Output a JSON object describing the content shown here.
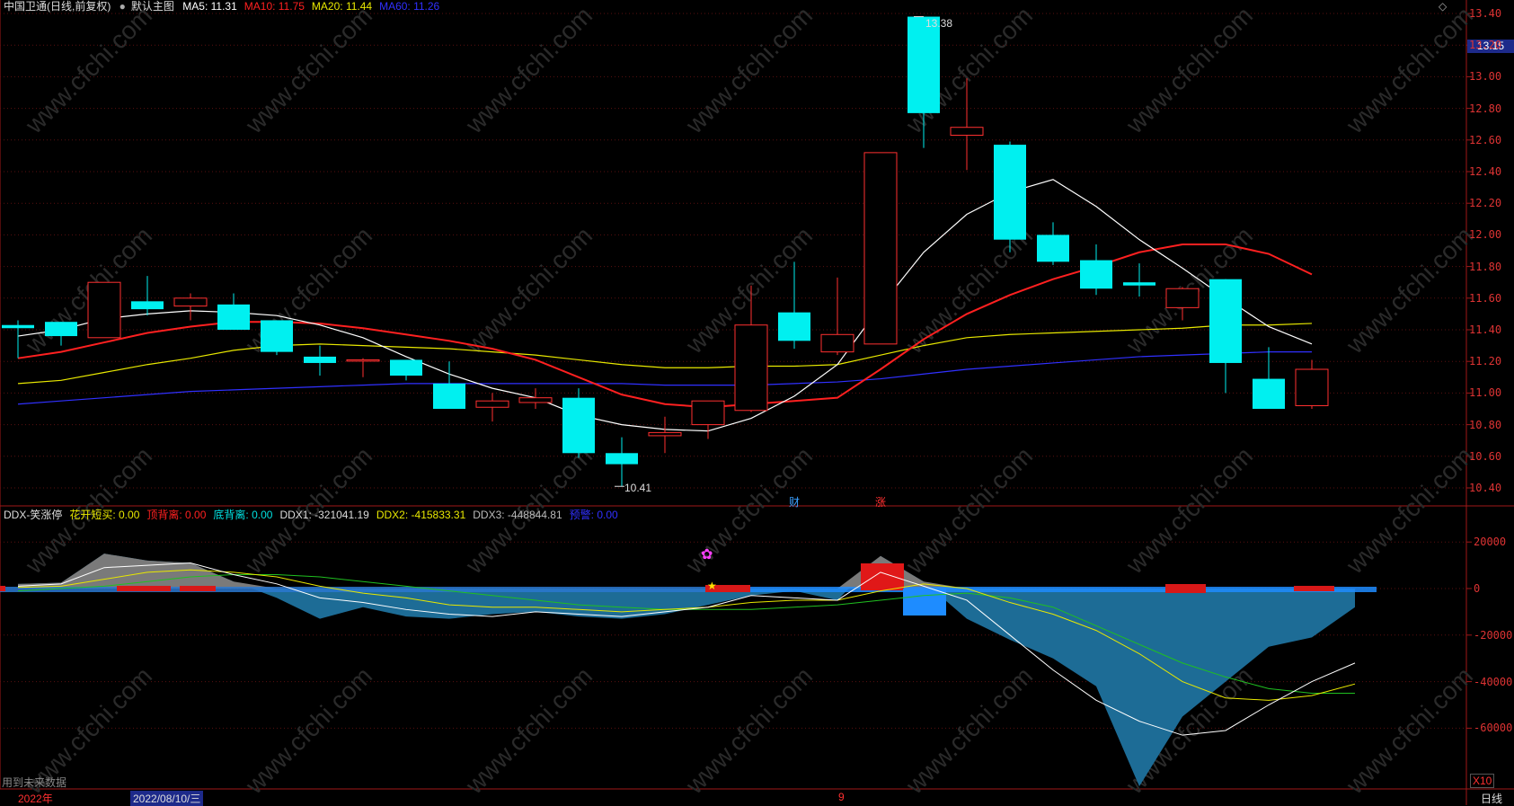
{
  "window": {
    "title": "中国卫通(日线,前复权)",
    "main_view": "默认主图",
    "top_right_icon": "diamond-icon"
  },
  "main_indicators": [
    {
      "label": "MA5: 11.31",
      "color": "#ffffff"
    },
    {
      "label": "MA10: 11.75",
      "color": "#ff2020"
    },
    {
      "label": "MA20: 11.44",
      "color": "#e8e800"
    },
    {
      "label": "MA60: 11.26",
      "color": "#3030ff"
    }
  ],
  "sub_indicators": [
    {
      "label": "DDX-笑涨停",
      "color": "#dddddd"
    },
    {
      "label": "花开短买: 0.00",
      "color": "#e8e800"
    },
    {
      "label": "顶背离: 0.00",
      "color": "#ff2020"
    },
    {
      "label": "底背离: 0.00",
      "color": "#00e0e0"
    },
    {
      "label": "DDX1: -321041.19",
      "color": "#dddddd"
    },
    {
      "label": "DDX2: -415833.31",
      "color": "#e8e800"
    },
    {
      "label": "DDX3: -448844.81",
      "color": "#bbbbbb"
    },
    {
      "label": "预警: 0.00",
      "color": "#3030ff"
    }
  ],
  "price_axis": [
    "13.40",
    "13.20",
    "13.00",
    "12.80",
    "12.60",
    "12.40",
    "12.20",
    "12.00",
    "11.80",
    "11.60",
    "11.40",
    "11.20",
    "11.00",
    "10.80",
    "10.60",
    "10.40"
  ],
  "current_price": "13.15",
  "sub_axis": [
    "20000",
    "0",
    "-20000",
    "-40000",
    "-60000"
  ],
  "annotations": {
    "high": "13.38",
    "low": "10.41",
    "cai": "财",
    "zhang": "涨"
  },
  "footer": {
    "warning": "用到未来数据",
    "year": "2022年",
    "date": "2022/08/10/三",
    "mark": "9",
    "period": "日线",
    "zoom": "X10"
  },
  "watermark": "www.cfchi.com",
  "chart_data": {
    "type": "candlestick",
    "candles": [
      {
        "o": 11.43,
        "h": 11.46,
        "l": 11.22,
        "c": 11.41
      },
      {
        "o": 11.45,
        "h": 11.45,
        "l": 11.3,
        "c": 11.36
      },
      {
        "o": 11.35,
        "h": 11.7,
        "l": 11.35,
        "c": 11.7
      },
      {
        "o": 11.58,
        "h": 11.74,
        "l": 11.49,
        "c": 11.53
      },
      {
        "o": 11.55,
        "h": 11.63,
        "l": 11.46,
        "c": 11.6
      },
      {
        "o": 11.56,
        "h": 11.63,
        "l": 11.4,
        "c": 11.4
      },
      {
        "o": 11.46,
        "h": 11.46,
        "l": 11.24,
        "c": 11.26
      },
      {
        "o": 11.23,
        "h": 11.3,
        "l": 11.11,
        "c": 11.19
      },
      {
        "o": 11.21,
        "h": 11.22,
        "l": 11.1,
        "c": 11.21
      },
      {
        "o": 11.21,
        "h": 11.21,
        "l": 11.08,
        "c": 11.11
      },
      {
        "o": 11.06,
        "h": 11.2,
        "l": 10.9,
        "c": 10.9
      },
      {
        "o": 10.91,
        "h": 11.0,
        "l": 10.82,
        "c": 10.95
      },
      {
        "o": 10.94,
        "h": 11.03,
        "l": 10.9,
        "c": 10.97
      },
      {
        "o": 10.97,
        "h": 11.03,
        "l": 10.59,
        "c": 10.62
      },
      {
        "o": 10.62,
        "h": 10.72,
        "l": 10.41,
        "c": 10.55
      },
      {
        "o": 10.73,
        "h": 10.85,
        "l": 10.62,
        "c": 10.75
      },
      {
        "o": 10.8,
        "h": 10.94,
        "l": 10.71,
        "c": 10.95
      },
      {
        "o": 10.89,
        "h": 11.68,
        "l": 10.88,
        "c": 11.43
      },
      {
        "o": 11.51,
        "h": 11.83,
        "l": 11.28,
        "c": 11.33
      },
      {
        "o": 11.26,
        "h": 11.73,
        "l": 11.24,
        "c": 11.37
      },
      {
        "o": 11.31,
        "h": 12.52,
        "l": 11.31,
        "c": 12.52
      },
      {
        "o": 13.38,
        "h": 13.38,
        "l": 12.55,
        "c": 12.77
      },
      {
        "o": 12.63,
        "h": 12.99,
        "l": 12.41,
        "c": 12.68
      },
      {
        "o": 12.57,
        "h": 12.59,
        "l": 11.89,
        "c": 11.97
      },
      {
        "o": 12.0,
        "h": 12.08,
        "l": 11.81,
        "c": 11.83
      },
      {
        "o": 11.84,
        "h": 11.94,
        "l": 11.62,
        "c": 11.66
      },
      {
        "o": 11.7,
        "h": 11.82,
        "l": 11.61,
        "c": 11.68
      },
      {
        "o": 11.54,
        "h": 11.67,
        "l": 11.46,
        "c": 11.66
      },
      {
        "o": 11.72,
        "h": 11.72,
        "l": 11.0,
        "c": 11.19
      },
      {
        "o": 11.09,
        "h": 11.29,
        "l": 10.9,
        "c": 10.9
      },
      {
        "o": 10.92,
        "h": 11.21,
        "l": 10.9,
        "c": 11.15
      }
    ],
    "ma5": [
      11.36,
      11.4,
      11.47,
      11.5,
      11.52,
      11.51,
      11.49,
      11.43,
      11.35,
      11.23,
      11.12,
      11.03,
      10.97,
      10.86,
      10.8,
      10.77,
      10.76,
      10.84,
      10.98,
      11.18,
      11.55,
      11.89,
      12.13,
      12.27,
      12.35,
      12.18,
      11.97,
      11.79,
      11.6,
      11.42,
      11.31
    ],
    "ma10": [
      11.22,
      11.26,
      11.32,
      11.38,
      11.42,
      11.45,
      11.45,
      11.44,
      11.41,
      11.37,
      11.33,
      11.28,
      11.21,
      11.1,
      10.99,
      10.93,
      10.91,
      10.93,
      10.95,
      10.97,
      11.15,
      11.34,
      11.5,
      11.62,
      11.72,
      11.8,
      11.89,
      11.94,
      11.94,
      11.88,
      11.75
    ],
    "ma20": [
      11.06,
      11.08,
      11.13,
      11.18,
      11.22,
      11.27,
      11.3,
      11.31,
      11.3,
      11.29,
      11.28,
      11.26,
      11.24,
      11.21,
      11.18,
      11.16,
      11.16,
      11.17,
      11.17,
      11.18,
      11.24,
      11.3,
      11.35,
      11.37,
      11.38,
      11.39,
      11.4,
      11.41,
      11.43,
      11.43,
      11.44
    ],
    "ma60": [
      10.93,
      10.95,
      10.97,
      10.99,
      11.01,
      11.02,
      11.03,
      11.04,
      11.05,
      11.06,
      11.06,
      11.06,
      11.06,
      11.06,
      11.06,
      11.05,
      11.05,
      11.05,
      11.06,
      11.07,
      11.09,
      11.12,
      11.15,
      11.17,
      11.19,
      11.21,
      11.23,
      11.24,
      11.25,
      11.26,
      11.26
    ],
    "ddx_area": [
      2000,
      2500,
      15000,
      12000,
      11000,
      3000,
      -4000,
      -13000,
      -8000,
      -12000,
      -13000,
      -11000,
      -10000,
      -12000,
      -13000,
      -11000,
      -7000,
      -3000,
      -1000,
      -5000,
      14000,
      3000,
      -13000,
      -22000,
      -30000,
      -42000,
      -85000,
      -55000,
      -40000,
      -25000,
      -21000,
      -8000
    ],
    "ddx1": [
      1000,
      2000,
      9000,
      10000,
      11000,
      6000,
      2000,
      -4000,
      -6000,
      -9000,
      -11000,
      -12000,
      -10000,
      -11000,
      -12000,
      -10000,
      -8000,
      -3000,
      -4000,
      -5000,
      7000,
      1000,
      -5000,
      -20000,
      -35000,
      -48000,
      -57000,
      -63000,
      -61000,
      -50000,
      -40000,
      -32000
    ],
    "ddx2": [
      500,
      1000,
      4000,
      7000,
      8000,
      7000,
      5000,
      1000,
      -2000,
      -4000,
      -7000,
      -8000,
      -8000,
      -9000,
      -10000,
      -9000,
      -8000,
      -6000,
      -5000,
      -5000,
      -1000,
      2000,
      0,
      -6000,
      -11000,
      -18000,
      -28000,
      -40000,
      -47000,
      -48000,
      -46000,
      -41000
    ],
    "ddx3": [
      -1000,
      0,
      1000,
      3000,
      5000,
      6000,
      6000,
      5000,
      3000,
      1000,
      -1000,
      -3000,
      -5000,
      -7000,
      -8000,
      -9000,
      -9000,
      -9000,
      -8000,
      -7000,
      -5000,
      -3000,
      -2000,
      -4000,
      -8000,
      -16000,
      -24000,
      -32000,
      -38000,
      -43000,
      -45000,
      -45000
    ]
  }
}
